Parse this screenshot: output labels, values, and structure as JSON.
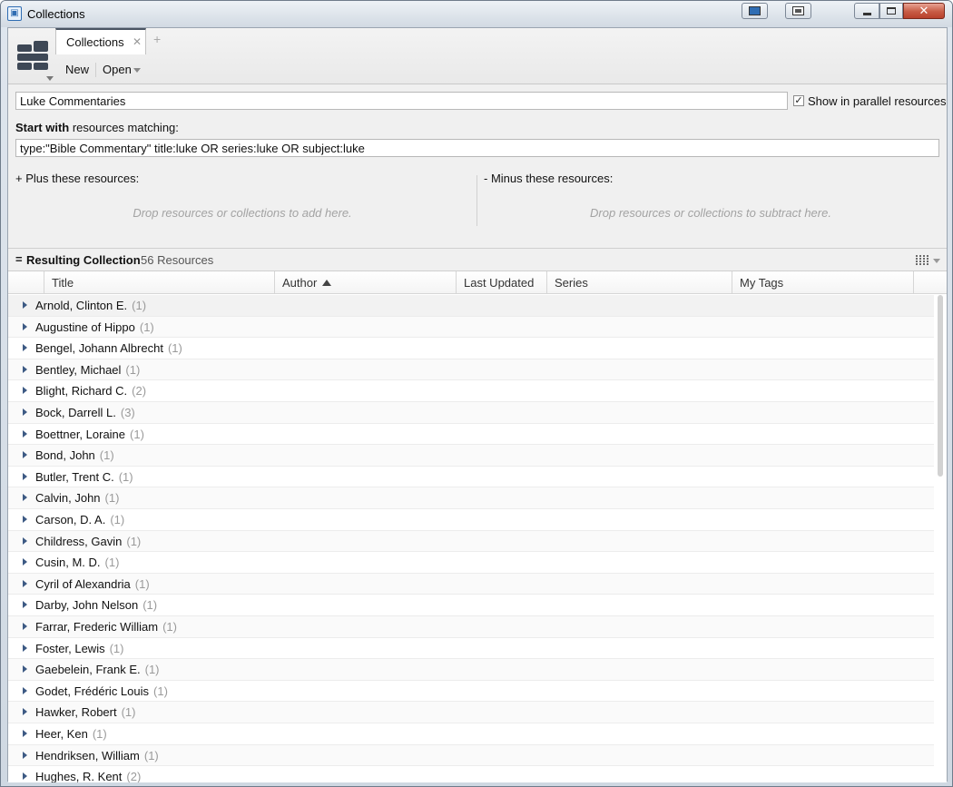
{
  "window": {
    "title": "Collections",
    "app_icon": "logos-app-icon",
    "buttons": [
      "screen-icon",
      "window-icon",
      "minimize-icon",
      "maximize-icon",
      "close-icon"
    ],
    "close_glyph": "✕",
    "close_color": "#c75b45"
  },
  "tabs": {
    "active_label": "Collections",
    "close_glyph": "✕",
    "add_glyph": "+"
  },
  "toolbar": {
    "new_label": "New",
    "open_label": "Open"
  },
  "editor": {
    "collection_name": "Luke Commentaries",
    "show_parallel_label": "Show in parallel resources",
    "show_parallel_checked": true,
    "check_glyph": "✓",
    "start_bold": "Start with",
    "start_rest": " resources matching:",
    "query": "type:\"Bible Commentary\" title:luke OR series:luke OR subject:luke",
    "plus_label": "+  Plus these resources:",
    "minus_label": "-  Minus these resources:",
    "drop_plus": "Drop resources or collections to add here.",
    "drop_minus": "Drop resources or collections to subtract here."
  },
  "result": {
    "eq": "=",
    "title": "Resulting Collection",
    "count": "56 Resources"
  },
  "columns": {
    "title": "Title",
    "author": "Author",
    "updated": "Last Updated",
    "series": "Series",
    "tags": "My Tags"
  },
  "rows": [
    {
      "name": "Arnold, Clinton E.",
      "count": "(1)"
    },
    {
      "name": "Augustine of Hippo",
      "count": "(1)"
    },
    {
      "name": "Bengel, Johann Albrecht",
      "count": "(1)"
    },
    {
      "name": "Bentley, Michael",
      "count": "(1)"
    },
    {
      "name": "Blight, Richard C.",
      "count": "(2)"
    },
    {
      "name": "Bock, Darrell L.",
      "count": "(3)"
    },
    {
      "name": "Boettner, Loraine",
      "count": "(1)"
    },
    {
      "name": "Bond, John",
      "count": "(1)"
    },
    {
      "name": "Butler, Trent C.",
      "count": "(1)"
    },
    {
      "name": "Calvin, John",
      "count": "(1)"
    },
    {
      "name": "Carson, D. A.",
      "count": "(1)"
    },
    {
      "name": "Childress, Gavin",
      "count": "(1)"
    },
    {
      "name": "Cusin, M. D.",
      "count": "(1)"
    },
    {
      "name": "Cyril of Alexandria",
      "count": "(1)"
    },
    {
      "name": "Darby, John Nelson",
      "count": "(1)"
    },
    {
      "name": "Farrar, Frederic William",
      "count": "(1)"
    },
    {
      "name": "Foster, Lewis",
      "count": "(1)"
    },
    {
      "name": "Gaebelein, Frank E.",
      "count": "(1)"
    },
    {
      "name": "Godet, Frédéric Louis",
      "count": "(1)"
    },
    {
      "name": "Hawker, Robert",
      "count": "(1)"
    },
    {
      "name": "Heer, Ken",
      "count": "(1)"
    },
    {
      "name": "Hendriksen, William",
      "count": "(1)"
    },
    {
      "name": "Hughes, R. Kent",
      "count": "(2)"
    }
  ]
}
